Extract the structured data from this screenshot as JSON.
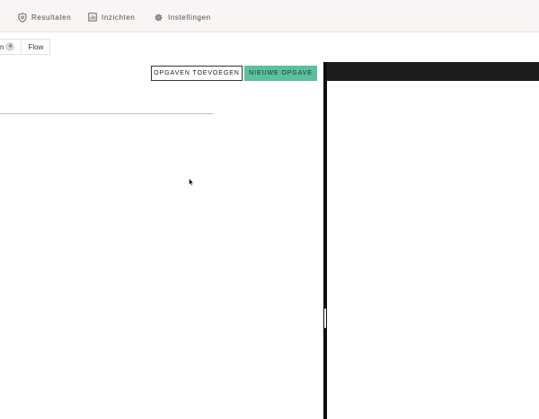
{
  "nav": {
    "items": [
      {
        "label": "Resultaten",
        "icon": "shield-icon"
      },
      {
        "label": "Inzichten",
        "icon": "chart-icon"
      },
      {
        "label": "Instellingen",
        "icon": "gear-icon"
      }
    ]
  },
  "tabs": {
    "first_label": "n",
    "first_badge": "4",
    "second_label": "Flow"
  },
  "actions": {
    "add_existing_label": "OPGAVEN TOEVOEGEN",
    "new_label": "NIEUWE OPGAVE"
  },
  "colors": {
    "accent": "#5cbf9f",
    "nav_background": "#faf5f4",
    "panel_header": "#1d1d1d"
  }
}
